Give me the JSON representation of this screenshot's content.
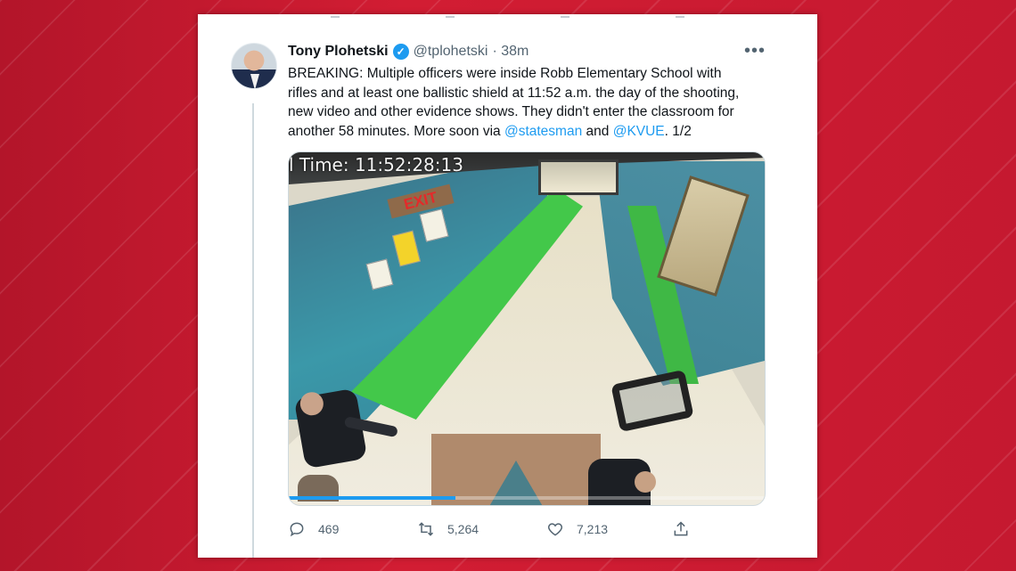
{
  "tweet": {
    "author_name": "Tony Plohetski",
    "handle": "@tplohetski",
    "time": "· 38m",
    "more_label": "•••",
    "verified_mark": "✓",
    "text_main": "BREAKING: Multiple officers were inside Robb Elementary School with rifles and at least one ballistic shield at 11:52 a.m. the day of the shooting, new video and other evidence shows. They didn't enter the classroom for another 58 minutes. More soon via ",
    "mention_1": "@statesman",
    "text_and": " and ",
    "mention_2": "@KVUE",
    "text_tail": ". 1/2"
  },
  "media": {
    "timestamp": "l Time: 11:52:28:13",
    "exit_sign": "EXIT",
    "progress_fraction": 0.35
  },
  "actions": {
    "replies": "469",
    "retweets": "5,264",
    "likes": "7,213"
  },
  "icons": [
    "reply-icon",
    "retweet-icon",
    "like-icon",
    "share-icon",
    "verified-icon",
    "more-icon"
  ],
  "colors": {
    "background": "#c8192e",
    "link": "#1d9bf0",
    "text": "#0f1419",
    "muted": "#536471"
  }
}
